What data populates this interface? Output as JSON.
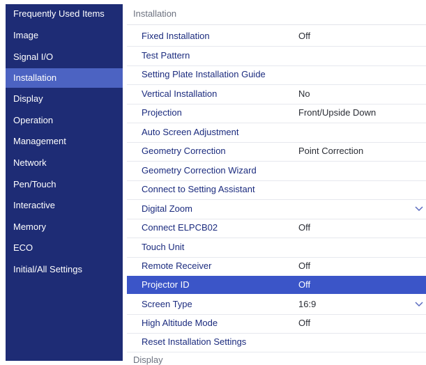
{
  "sidebar": {
    "items": [
      {
        "label": "Frequently Used Items"
      },
      {
        "label": "Image"
      },
      {
        "label": "Signal I/O"
      },
      {
        "label": "Installation"
      },
      {
        "label": "Display"
      },
      {
        "label": "Operation"
      },
      {
        "label": "Management"
      },
      {
        "label": "Network"
      },
      {
        "label": "Pen/Touch"
      },
      {
        "label": "Interactive"
      },
      {
        "label": "Memory"
      },
      {
        "label": "ECO"
      },
      {
        "label": "Initial/All Settings"
      }
    ],
    "active_item": "Installation"
  },
  "main": {
    "section_title": "Installation",
    "rows": [
      {
        "label": "Fixed Installation",
        "value": "Off"
      },
      {
        "label": "Test Pattern",
        "value": ""
      },
      {
        "label": "Setting Plate Installation Guide",
        "value": ""
      },
      {
        "label": "Vertical Installation",
        "value": "No"
      },
      {
        "label": "Projection",
        "value": "Front/Upside Down"
      },
      {
        "label": "Auto Screen Adjustment",
        "value": ""
      },
      {
        "label": "Geometry Correction",
        "value": "Point Correction"
      },
      {
        "label": "Geometry Correction Wizard",
        "value": ""
      },
      {
        "label": "Connect to Setting Assistant",
        "value": ""
      },
      {
        "label": "Digital Zoom",
        "value": "",
        "expandable": true
      },
      {
        "label": "Connect ELPCB02",
        "value": "Off"
      },
      {
        "label": "Touch Unit",
        "value": ""
      },
      {
        "label": "Remote Receiver",
        "value": "Off"
      },
      {
        "label": "Projector ID",
        "value": "Off",
        "selected": true
      },
      {
        "label": "Screen Type",
        "value": "16:9",
        "expandable": true
      },
      {
        "label": "High Altitude Mode",
        "value": "Off"
      },
      {
        "label": "Reset Installation Settings",
        "value": ""
      }
    ],
    "next_section_title": "Display"
  },
  "colors": {
    "sidebar_bg": "#1e2c75",
    "sidebar_active": "#4c63c2",
    "row_text": "#1b2b7e",
    "row_selected_bg": "#3b55c8"
  },
  "icons": {
    "expand": "chevron-down-icon"
  }
}
